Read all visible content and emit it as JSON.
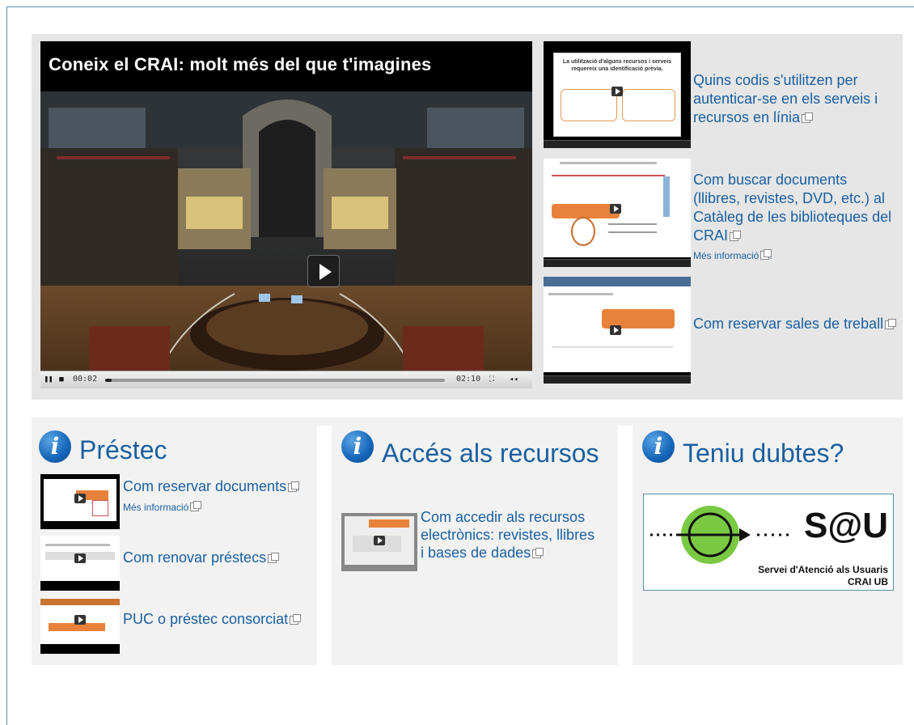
{
  "main_video": {
    "title": "Coneix el CRAI: molt més del que t'imagines",
    "time_current": "00:02",
    "time_total": "02:10",
    "progress": 0.02
  },
  "side_videos": [
    {
      "link": "Quins codis s'utilitzen per autenticar-se en els serveis i recursos en línia",
      "thumb_title": "La utilització d'alguns recursos i serveis requereix una identificació prèvia."
    },
    {
      "link": "Com buscar documents (llibres, revistes, DVD, etc.) al Catàleg de les biblioteques del CRAI",
      "more": "Més informació"
    },
    {
      "link": "Com reservar sales de treball"
    }
  ],
  "boxes": [
    {
      "title": "Préstec",
      "items": [
        {
          "link": "Com reservar documents",
          "more": "Més informació"
        },
        {
          "link": "Com renovar préstecs"
        },
        {
          "link": "PUC o préstec consorciat"
        }
      ]
    },
    {
      "title": "Accés als recursos",
      "items": [
        {
          "link": "Com accedir als recursos electrònics: revistes, llibres i bases de dades"
        }
      ]
    },
    {
      "title": "Teniu dubtes?",
      "banner": {
        "logo": "S@U",
        "line1": "Servei d'Atenció als Usuaris",
        "line2": "CRAI UB"
      }
    }
  ],
  "icons": {
    "info": "info-icon",
    "external": "external-link-icon",
    "play": "play-icon"
  },
  "colors": {
    "link": "#1a5fa0",
    "panel": "#e6e6e6",
    "box": "#f2f2f2",
    "sau_green": "#7ac943"
  }
}
